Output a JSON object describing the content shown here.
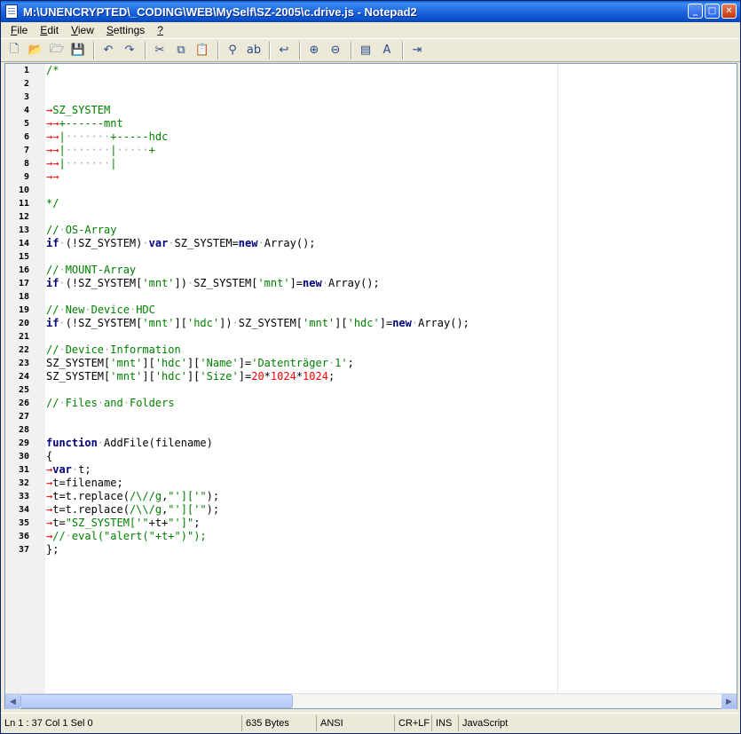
{
  "window": {
    "title": "M:\\UNENCRYPTED\\_CODING\\WEB\\MySelf\\SZ-2005\\c.drive.js - Notepad2"
  },
  "menu": [
    {
      "pre": "",
      "acc": "F",
      "post": "ile"
    },
    {
      "pre": "",
      "acc": "E",
      "post": "dit"
    },
    {
      "pre": "",
      "acc": "V",
      "post": "iew"
    },
    {
      "pre": "",
      "acc": "S",
      "post": "ettings"
    },
    {
      "pre": "",
      "acc": "?",
      "post": ""
    }
  ],
  "toolbar": [
    "new-icon",
    "open-icon",
    "browse-icon",
    "save-icon",
    "sep",
    "undo-icon",
    "redo-icon",
    "sep",
    "cut-icon",
    "copy-icon",
    "paste-icon",
    "sep",
    "find-icon",
    "replace-icon",
    "sep",
    "wordwrap-icon",
    "sep",
    "zoom-in-icon",
    "zoom-out-icon",
    "sep",
    "scheme-icon",
    "font-icon",
    "sep",
    "exit-icon"
  ],
  "line_numbers": [
    "1",
    "2",
    "3",
    "4",
    "5",
    "6",
    "7",
    "8",
    "9",
    "10",
    "11",
    "12",
    "13",
    "14",
    "15",
    "16",
    "17",
    "18",
    "19",
    "20",
    "21",
    "22",
    "23",
    "24",
    "25",
    "26",
    "27",
    "28",
    "29",
    "30",
    "31",
    "32",
    "33",
    "34",
    "35",
    "36",
    "37"
  ],
  "code": [
    [
      [
        "cm",
        "/*"
      ]
    ],
    [],
    [],
    [
      [
        "arr",
        "→"
      ],
      [
        "cm",
        "SZ_SYSTEM"
      ]
    ],
    [
      [
        "arr",
        "→→"
      ],
      [
        "cm",
        "+------mnt"
      ]
    ],
    [
      [
        "arr",
        "→→"
      ],
      [
        "cm",
        "|"
      ],
      [
        "dot",
        "·······"
      ],
      [
        "cm",
        "+-----hdc"
      ]
    ],
    [
      [
        "arr",
        "→→"
      ],
      [
        "cm",
        "|"
      ],
      [
        "dot",
        "·······"
      ],
      [
        "cm",
        "|"
      ],
      [
        "dot",
        "·····"
      ],
      [
        "cm",
        "+"
      ]
    ],
    [
      [
        "arr",
        "→→"
      ],
      [
        "cm",
        "|"
      ],
      [
        "dot",
        "·······"
      ],
      [
        "cm",
        "|"
      ]
    ],
    [
      [
        "arr",
        "→→"
      ]
    ],
    [],
    [
      [
        "cm",
        "*/"
      ]
    ],
    [],
    [
      [
        "cm",
        "//"
      ],
      [
        "dot",
        "·"
      ],
      [
        "cm",
        "OS-Array"
      ]
    ],
    [
      [
        "kw",
        "if"
      ],
      [
        "dot",
        "·"
      ],
      [
        "",
        "(!SZ_SYSTEM)"
      ],
      [
        "dot",
        "·"
      ],
      [
        "kw",
        "var"
      ],
      [
        "dot",
        "·"
      ],
      [
        "",
        "SZ_SYSTEM="
      ],
      [
        "kw",
        "new"
      ],
      [
        "dot",
        "·"
      ],
      [
        "",
        "Array();"
      ]
    ],
    [],
    [
      [
        "cm",
        "//"
      ],
      [
        "dot",
        "·"
      ],
      [
        "cm",
        "MOUNT-Array"
      ]
    ],
    [
      [
        "kw",
        "if"
      ],
      [
        "dot",
        "·"
      ],
      [
        "",
        "(!SZ_SYSTEM["
      ],
      [
        "st",
        "'mnt'"
      ],
      [
        "",
        "])"
      ],
      [
        "dot",
        "·"
      ],
      [
        "",
        "SZ_SYSTEM["
      ],
      [
        "st",
        "'mnt'"
      ],
      [
        "",
        "]="
      ],
      [
        "kw",
        "new"
      ],
      [
        "dot",
        "·"
      ],
      [
        "",
        "Array();"
      ]
    ],
    [],
    [
      [
        "cm",
        "//"
      ],
      [
        "dot",
        "·"
      ],
      [
        "cm",
        "New"
      ],
      [
        "dot",
        "·"
      ],
      [
        "cm",
        "Device"
      ],
      [
        "dot",
        "·"
      ],
      [
        "cm",
        "HDC"
      ]
    ],
    [
      [
        "kw",
        "if"
      ],
      [
        "dot",
        "·"
      ],
      [
        "",
        "(!SZ_SYSTEM["
      ],
      [
        "st",
        "'mnt'"
      ],
      [
        "",
        "]["
      ],
      [
        "st",
        "'hdc'"
      ],
      [
        "",
        "])"
      ],
      [
        "dot",
        "·"
      ],
      [
        "",
        "SZ_SYSTEM["
      ],
      [
        "st",
        "'mnt'"
      ],
      [
        "",
        "]["
      ],
      [
        "st",
        "'hdc'"
      ],
      [
        "",
        "]="
      ],
      [
        "kw",
        "new"
      ],
      [
        "dot",
        "·"
      ],
      [
        "",
        "Array();"
      ]
    ],
    [],
    [
      [
        "cm",
        "//"
      ],
      [
        "dot",
        "·"
      ],
      [
        "cm",
        "Device"
      ],
      [
        "dot",
        "·"
      ],
      [
        "cm",
        "Information"
      ]
    ],
    [
      [
        "",
        "SZ_SYSTEM["
      ],
      [
        "st",
        "'mnt'"
      ],
      [
        "",
        "]["
      ],
      [
        "st",
        "'hdc'"
      ],
      [
        "",
        "]["
      ],
      [
        "st",
        "'Name'"
      ],
      [
        "",
        "]="
      ],
      [
        "st",
        "'Datenträger"
      ],
      [
        "dot",
        "·"
      ],
      [
        "st",
        "1'"
      ],
      [
        "",
        ";"
      ]
    ],
    [
      [
        "",
        "SZ_SYSTEM["
      ],
      [
        "st",
        "'mnt'"
      ],
      [
        "",
        "]["
      ],
      [
        "st",
        "'hdc'"
      ],
      [
        "",
        "]["
      ],
      [
        "st",
        "'Size'"
      ],
      [
        "",
        "]="
      ],
      [
        "num",
        "20"
      ],
      [
        "",
        "*"
      ],
      [
        "num",
        "1024"
      ],
      [
        "",
        "*"
      ],
      [
        "num",
        "1024"
      ],
      [
        "",
        ";"
      ]
    ],
    [],
    [
      [
        "cm",
        "//"
      ],
      [
        "dot",
        "·"
      ],
      [
        "cm",
        "Files"
      ],
      [
        "dot",
        "·"
      ],
      [
        "cm",
        "and"
      ],
      [
        "dot",
        "·"
      ],
      [
        "cm",
        "Folders"
      ]
    ],
    [],
    [],
    [
      [
        "kw",
        "function"
      ],
      [
        "dot",
        "·"
      ],
      [
        "",
        "AddFile(filename)"
      ]
    ],
    [
      [
        "",
        "{"
      ]
    ],
    [
      [
        "arr",
        "→"
      ],
      [
        "kw",
        "var"
      ],
      [
        "dot",
        "·"
      ],
      [
        "",
        "t;"
      ]
    ],
    [
      [
        "arr",
        "→"
      ],
      [
        "",
        "t=filename;"
      ]
    ],
    [
      [
        "arr",
        "→"
      ],
      [
        "",
        "t=t.replace("
      ],
      [
        "st",
        "/\\//g"
      ],
      [
        "",
        ","
      ],
      [
        "st",
        "\"']['\""
      ],
      [
        "",
        ");"
      ]
    ],
    [
      [
        "arr",
        "→"
      ],
      [
        "",
        "t=t.replace("
      ],
      [
        "st",
        "/\\\\/g"
      ],
      [
        "",
        ","
      ],
      [
        "st",
        "\"']['\""
      ],
      [
        "",
        ");"
      ]
    ],
    [
      [
        "arr",
        "→"
      ],
      [
        "",
        "t="
      ],
      [
        "st",
        "\"SZ_SYSTEM['\""
      ],
      [
        "",
        "+t+"
      ],
      [
        "st",
        "\"']\""
      ],
      [
        "",
        ";"
      ]
    ],
    [
      [
        "arr",
        "→"
      ],
      [
        "cm",
        "//"
      ],
      [
        "dot",
        "·"
      ],
      [
        "cm",
        "eval(\"alert(\"+t+\")\");"
      ]
    ],
    [
      [
        "",
        "};"
      ]
    ]
  ],
  "status": {
    "position": "Ln 1 : 37   Col 1   Sel 0",
    "size": "635 Bytes",
    "encoding": "ANSI",
    "eol": "CR+LF",
    "mode": "INS",
    "lexer": "JavaScript"
  }
}
